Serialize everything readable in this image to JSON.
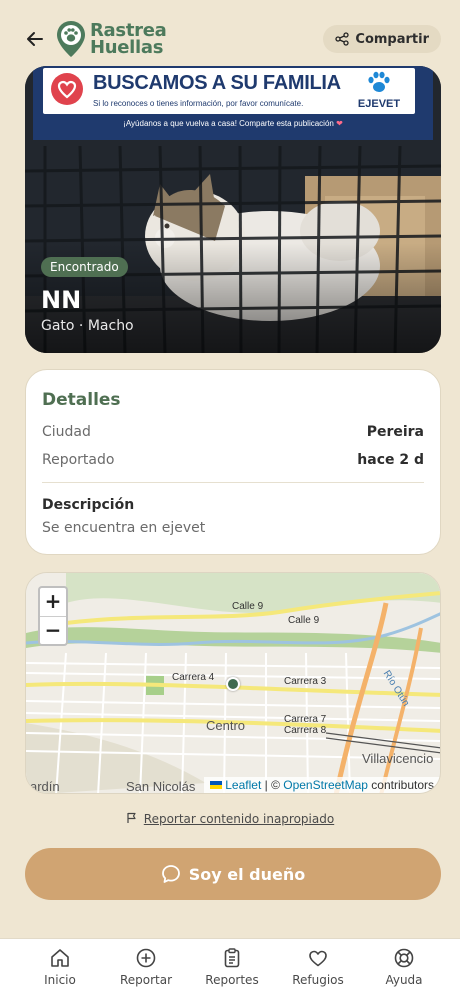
{
  "header": {
    "back_icon": "arrow-left-icon",
    "logo_line1": "Rastrea",
    "logo_line2": "Huellas",
    "share_label": "Compartir",
    "share_icon": "share-icon"
  },
  "banner": {
    "title": "BUSCAMOS A SU FAMILIA",
    "subtitle": "Si lo reconoces o tienes información, por favor comunícate.",
    "org_name": "EJEVET",
    "footer": "¡Ayúdanos a que vuelva a casa!  Comparte esta publicación"
  },
  "pet": {
    "status": "Encontrado",
    "name": "NN",
    "meta": "Gato · Macho"
  },
  "details": {
    "title": "Detalles",
    "city_label": "Ciudad",
    "city_value": "Pereira",
    "reported_label": "Reportado",
    "reported_value": "hace 2 d",
    "description_title": "Descripción",
    "description_text": "Se encuentra en ejevet"
  },
  "map": {
    "zoom_in": "+",
    "zoom_out": "−",
    "labels": {
      "calle9a": "Calle 9",
      "calle9b": "Calle 9",
      "carrera4": "Carrera 4",
      "carrera3": "Carrera 3",
      "centro": "Centro",
      "carrera7": "Carrera 7",
      "carrera8": "Carrera 8",
      "villavicencio": "Villavicencio",
      "sannicolas": "San Nicolás",
      "dardin": "ardín",
      "rio": "Río Otún"
    },
    "attribution": {
      "leaflet": "Leaflet",
      "sep": " | © ",
      "osm": "OpenStreetMap",
      "contributors": " contributors"
    }
  },
  "report_link": "Reportar contenido inapropiado",
  "owner_button": "Soy el dueño",
  "nav": {
    "items": [
      {
        "label": "Inicio",
        "icon": "home-icon"
      },
      {
        "label": "Reportar",
        "icon": "plus-circle-icon"
      },
      {
        "label": "Reportes",
        "icon": "clipboard-icon"
      },
      {
        "label": "Refugios",
        "icon": "heart-icon"
      },
      {
        "label": "Ayuda",
        "icon": "lifebuoy-icon"
      }
    ]
  },
  "colors": {
    "background": "#efe6d2",
    "brand_green": "#4d7a5c",
    "accent_tan": "#d0a472",
    "banner_blue": "#1f3a6e"
  }
}
